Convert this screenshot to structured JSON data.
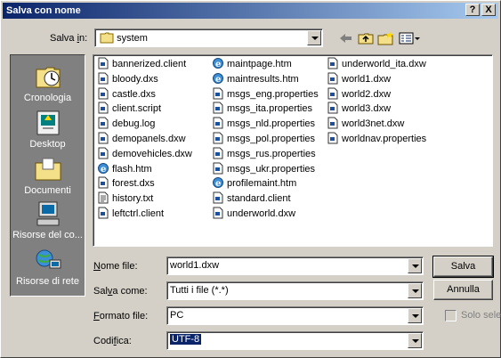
{
  "title": "Salva con nome",
  "title_buttons": {
    "help": "?",
    "close": "X"
  },
  "savein": {
    "label_prefix": "Salva ",
    "label_hotkey": "i",
    "label_suffix": "n:",
    "value": "system"
  },
  "toolbar": {
    "back": "back-arrow-icon",
    "up": "folder-up-icon",
    "new_folder": "new-folder-icon",
    "views": "views-menu-icon"
  },
  "places": [
    {
      "label": "Cronologia",
      "icon": "history-icon"
    },
    {
      "label": "Desktop",
      "icon": "desktop-icon"
    },
    {
      "label": "Documenti",
      "icon": "documents-folder-icon"
    },
    {
      "label": "Risorse del co...",
      "icon": "my-computer-icon"
    },
    {
      "label": "Risorse di rete",
      "icon": "network-places-icon"
    }
  ],
  "files": {
    "col1": [
      {
        "name": "bannerized.client",
        "icon": "generic"
      },
      {
        "name": "bloody.dxs",
        "icon": "generic"
      },
      {
        "name": "castle.dxs",
        "icon": "generic"
      },
      {
        "name": "client.script",
        "icon": "generic"
      },
      {
        "name": "debug.log",
        "icon": "generic"
      },
      {
        "name": "demopanels.dxw",
        "icon": "generic"
      },
      {
        "name": "demovehicles.dxw",
        "icon": "generic"
      },
      {
        "name": "flash.htm",
        "icon": "ie"
      },
      {
        "name": "forest.dxs",
        "icon": "generic"
      },
      {
        "name": "history.txt",
        "icon": "text"
      },
      {
        "name": "leftctrl.client",
        "icon": "generic"
      }
    ],
    "col2": [
      {
        "name": "maintpage.htm",
        "icon": "ie"
      },
      {
        "name": "maintresults.htm",
        "icon": "ie"
      },
      {
        "name": "msgs_eng.properties",
        "icon": "generic"
      },
      {
        "name": "msgs_ita.properties",
        "icon": "generic"
      },
      {
        "name": "msgs_nld.properties",
        "icon": "generic"
      },
      {
        "name": "msgs_pol.properties",
        "icon": "generic"
      },
      {
        "name": "msgs_rus.properties",
        "icon": "generic"
      },
      {
        "name": "msgs_ukr.properties",
        "icon": "generic"
      },
      {
        "name": "profilemaint.htm",
        "icon": "ie"
      },
      {
        "name": "standard.client",
        "icon": "generic"
      },
      {
        "name": "underworld.dxw",
        "icon": "generic"
      }
    ],
    "col3": [
      {
        "name": "underworld_ita.dxw",
        "icon": "generic"
      },
      {
        "name": "world1.dxw",
        "icon": "generic"
      },
      {
        "name": "world2.dxw",
        "icon": "generic"
      },
      {
        "name": "world3.dxw",
        "icon": "generic"
      },
      {
        "name": "world3net.dxw",
        "icon": "generic"
      },
      {
        "name": "worldnav.properties",
        "icon": "generic"
      }
    ]
  },
  "fields": {
    "filename": {
      "hotkey": "N",
      "rest": "ome file:",
      "value": "world1.dxw"
    },
    "saveas": {
      "pre": "Sal",
      "hotkey": "v",
      "rest": "a come:",
      "value": "Tutti i file (*.*)"
    },
    "format": {
      "hotkey": "F",
      "rest": "ormato file:",
      "value": "PC"
    },
    "encoding": {
      "pre": "Codi",
      "hotkey": "f",
      "rest": "ica:",
      "value": "UTF-8"
    }
  },
  "buttons": {
    "save": "Salva",
    "cancel": "Annulla"
  },
  "readonly_checkbox": "Solo sele",
  "colors": {
    "title_start": "#0a246a",
    "title_end": "#a6caf0",
    "face": "#d4d0c8",
    "selection": "#0a246a"
  }
}
